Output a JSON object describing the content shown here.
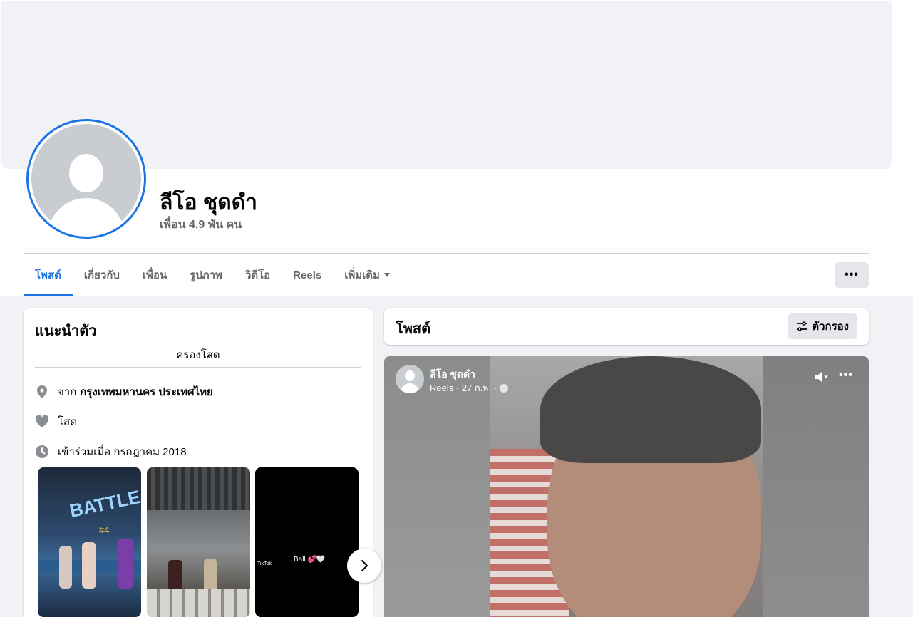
{
  "profile": {
    "name": "ลีโอ ชุดดำ",
    "friends": "เพื่อน 4.9 พัน คน"
  },
  "tabs": [
    {
      "label": "โพสต์",
      "active": true
    },
    {
      "label": "เกี่ยวกับ",
      "active": false
    },
    {
      "label": "เพื่อน",
      "active": false
    },
    {
      "label": "รูปภาพ",
      "active": false
    },
    {
      "label": "วิดีโอ",
      "active": false
    },
    {
      "label": "Reels",
      "active": false
    },
    {
      "label": "เพิ่มเติม",
      "active": false
    }
  ],
  "more_button": "•••",
  "intro": {
    "title": "แนะนำตัว",
    "bio": "ครองโสด",
    "location_prefix": "จาก",
    "location": "กรุงเทพมหานคร ประเทศไทย",
    "relationship": "โสด",
    "joined": "เข้าร่วมเมื่อ กรกฎาคม 2018",
    "photo1_label": "#4",
    "photo1_text": "BATTLE",
    "photo3_tiktok": "TikTok",
    "photo3_text": "Ball 💕🤍"
  },
  "posts": {
    "title": "โพสต์",
    "filter_label": "ตัวกรอง",
    "post": {
      "author": "ลีโอ ชุดดำ",
      "meta": "Reels · 27 ก.พ. ·",
      "more": "•••"
    }
  },
  "colors": {
    "accent": "#1b74e4",
    "background": "#f0f2f5",
    "secondary_text": "#65676b"
  }
}
